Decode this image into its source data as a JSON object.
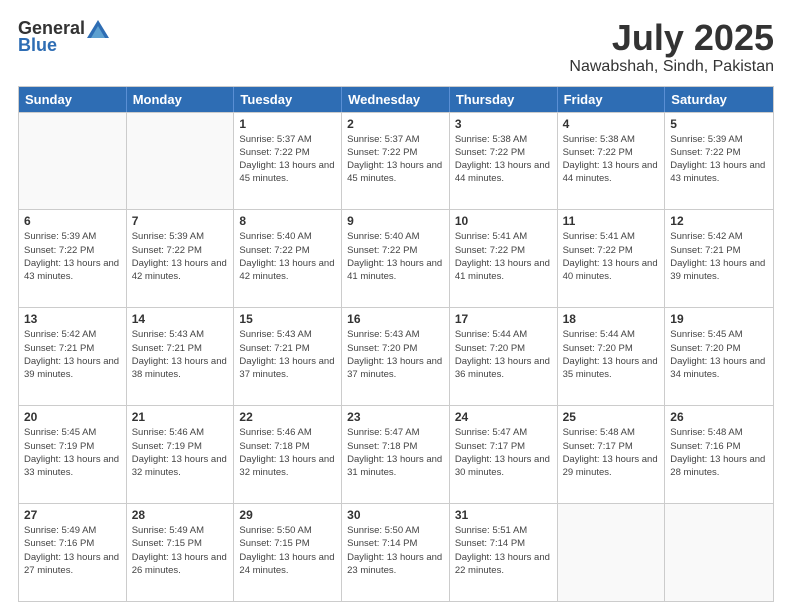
{
  "header": {
    "logo_general": "General",
    "logo_blue": "Blue",
    "month": "July 2025",
    "location": "Nawabshah, Sindh, Pakistan"
  },
  "days_of_week": [
    "Sunday",
    "Monday",
    "Tuesday",
    "Wednesday",
    "Thursday",
    "Friday",
    "Saturday"
  ],
  "weeks": [
    [
      {
        "day": "",
        "info": ""
      },
      {
        "day": "",
        "info": ""
      },
      {
        "day": "1",
        "info": "Sunrise: 5:37 AM\nSunset: 7:22 PM\nDaylight: 13 hours and 45 minutes."
      },
      {
        "day": "2",
        "info": "Sunrise: 5:37 AM\nSunset: 7:22 PM\nDaylight: 13 hours and 45 minutes."
      },
      {
        "day": "3",
        "info": "Sunrise: 5:38 AM\nSunset: 7:22 PM\nDaylight: 13 hours and 44 minutes."
      },
      {
        "day": "4",
        "info": "Sunrise: 5:38 AM\nSunset: 7:22 PM\nDaylight: 13 hours and 44 minutes."
      },
      {
        "day": "5",
        "info": "Sunrise: 5:39 AM\nSunset: 7:22 PM\nDaylight: 13 hours and 43 minutes."
      }
    ],
    [
      {
        "day": "6",
        "info": "Sunrise: 5:39 AM\nSunset: 7:22 PM\nDaylight: 13 hours and 43 minutes."
      },
      {
        "day": "7",
        "info": "Sunrise: 5:39 AM\nSunset: 7:22 PM\nDaylight: 13 hours and 42 minutes."
      },
      {
        "day": "8",
        "info": "Sunrise: 5:40 AM\nSunset: 7:22 PM\nDaylight: 13 hours and 42 minutes."
      },
      {
        "day": "9",
        "info": "Sunrise: 5:40 AM\nSunset: 7:22 PM\nDaylight: 13 hours and 41 minutes."
      },
      {
        "day": "10",
        "info": "Sunrise: 5:41 AM\nSunset: 7:22 PM\nDaylight: 13 hours and 41 minutes."
      },
      {
        "day": "11",
        "info": "Sunrise: 5:41 AM\nSunset: 7:22 PM\nDaylight: 13 hours and 40 minutes."
      },
      {
        "day": "12",
        "info": "Sunrise: 5:42 AM\nSunset: 7:21 PM\nDaylight: 13 hours and 39 minutes."
      }
    ],
    [
      {
        "day": "13",
        "info": "Sunrise: 5:42 AM\nSunset: 7:21 PM\nDaylight: 13 hours and 39 minutes."
      },
      {
        "day": "14",
        "info": "Sunrise: 5:43 AM\nSunset: 7:21 PM\nDaylight: 13 hours and 38 minutes."
      },
      {
        "day": "15",
        "info": "Sunrise: 5:43 AM\nSunset: 7:21 PM\nDaylight: 13 hours and 37 minutes."
      },
      {
        "day": "16",
        "info": "Sunrise: 5:43 AM\nSunset: 7:20 PM\nDaylight: 13 hours and 37 minutes."
      },
      {
        "day": "17",
        "info": "Sunrise: 5:44 AM\nSunset: 7:20 PM\nDaylight: 13 hours and 36 minutes."
      },
      {
        "day": "18",
        "info": "Sunrise: 5:44 AM\nSunset: 7:20 PM\nDaylight: 13 hours and 35 minutes."
      },
      {
        "day": "19",
        "info": "Sunrise: 5:45 AM\nSunset: 7:20 PM\nDaylight: 13 hours and 34 minutes."
      }
    ],
    [
      {
        "day": "20",
        "info": "Sunrise: 5:45 AM\nSunset: 7:19 PM\nDaylight: 13 hours and 33 minutes."
      },
      {
        "day": "21",
        "info": "Sunrise: 5:46 AM\nSunset: 7:19 PM\nDaylight: 13 hours and 32 minutes."
      },
      {
        "day": "22",
        "info": "Sunrise: 5:46 AM\nSunset: 7:18 PM\nDaylight: 13 hours and 32 minutes."
      },
      {
        "day": "23",
        "info": "Sunrise: 5:47 AM\nSunset: 7:18 PM\nDaylight: 13 hours and 31 minutes."
      },
      {
        "day": "24",
        "info": "Sunrise: 5:47 AM\nSunset: 7:17 PM\nDaylight: 13 hours and 30 minutes."
      },
      {
        "day": "25",
        "info": "Sunrise: 5:48 AM\nSunset: 7:17 PM\nDaylight: 13 hours and 29 minutes."
      },
      {
        "day": "26",
        "info": "Sunrise: 5:48 AM\nSunset: 7:16 PM\nDaylight: 13 hours and 28 minutes."
      }
    ],
    [
      {
        "day": "27",
        "info": "Sunrise: 5:49 AM\nSunset: 7:16 PM\nDaylight: 13 hours and 27 minutes."
      },
      {
        "day": "28",
        "info": "Sunrise: 5:49 AM\nSunset: 7:15 PM\nDaylight: 13 hours and 26 minutes."
      },
      {
        "day": "29",
        "info": "Sunrise: 5:50 AM\nSunset: 7:15 PM\nDaylight: 13 hours and 24 minutes."
      },
      {
        "day": "30",
        "info": "Sunrise: 5:50 AM\nSunset: 7:14 PM\nDaylight: 13 hours and 23 minutes."
      },
      {
        "day": "31",
        "info": "Sunrise: 5:51 AM\nSunset: 7:14 PM\nDaylight: 13 hours and 22 minutes."
      },
      {
        "day": "",
        "info": ""
      },
      {
        "day": "",
        "info": ""
      }
    ]
  ]
}
